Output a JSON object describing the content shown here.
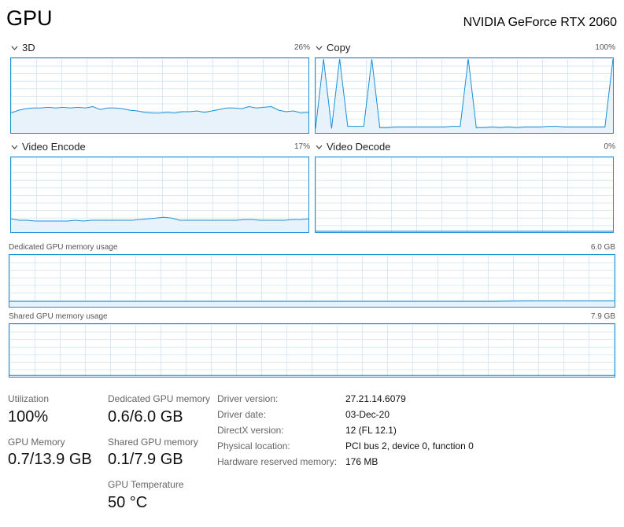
{
  "header": {
    "title": "GPU",
    "gpu_name": "NVIDIA GeForce RTX 2060"
  },
  "engines": [
    {
      "label": "3D",
      "percent": "26%"
    },
    {
      "label": "Copy",
      "percent": "100%"
    },
    {
      "label": "Video Encode",
      "percent": "17%"
    },
    {
      "label": "Video Decode",
      "percent": "0%"
    }
  ],
  "memory_graphs": {
    "dedicated": {
      "label": "Dedicated GPU memory usage",
      "max": "6.0 GB"
    },
    "shared": {
      "label": "Shared GPU memory usage",
      "max": "7.9 GB"
    }
  },
  "stats": {
    "utilization": {
      "label": "Utilization",
      "value": "100%"
    },
    "dedicated_memory": {
      "label": "Dedicated GPU memory",
      "value": "0.6/6.0 GB"
    },
    "gpu_memory": {
      "label": "GPU Memory",
      "value": "0.7/13.9 GB"
    },
    "shared_memory": {
      "label": "Shared GPU memory",
      "value": "0.1/7.9 GB"
    },
    "temperature": {
      "label": "GPU Temperature",
      "value": "50 °C"
    }
  },
  "details": [
    {
      "label": "Driver version:",
      "value": "27.21.14.6079"
    },
    {
      "label": "Driver date:",
      "value": "03-Dec-20"
    },
    {
      "label": "DirectX version:",
      "value": "12 (FL 12.1)"
    },
    {
      "label": "Physical location:",
      "value": "PCI bus 2, device 0, function 0"
    },
    {
      "label": "Hardware reserved memory:",
      "value": "176 MB"
    }
  ],
  "colors": {
    "graph_line": "#1a8fd6",
    "graph_fill": "#e8f2fa",
    "grid": "#d6e9f5"
  },
  "chart_data": [
    {
      "type": "area",
      "series": [
        {
          "name": "3D",
          "values": [
            26,
            30,
            32,
            33,
            33,
            34,
            33,
            34,
            33,
            34,
            33,
            35,
            31,
            33,
            33,
            32,
            30,
            29,
            27,
            26,
            26,
            27,
            26,
            28,
            28,
            29,
            27,
            29,
            31,
            33,
            33,
            32,
            35,
            33,
            34,
            35,
            30,
            28,
            29,
            26,
            27
          ]
        }
      ],
      "ylim": [
        0,
        100
      ]
    },
    {
      "type": "area",
      "series": [
        {
          "name": "Copy",
          "values": [
            5,
            100,
            5,
            100,
            8,
            8,
            8,
            100,
            6,
            6,
            7,
            7,
            7,
            7,
            7,
            7,
            7,
            8,
            8,
            100,
            6,
            6,
            7,
            6,
            7,
            6,
            7,
            7,
            7,
            8,
            8,
            7,
            7,
            7,
            7,
            7,
            7,
            100
          ]
        }
      ],
      "ylim": [
        0,
        100
      ]
    },
    {
      "type": "area",
      "series": [
        {
          "name": "Video Encode",
          "values": [
            17,
            15,
            15,
            14,
            14,
            14,
            14,
            14,
            15,
            14,
            15,
            15,
            15,
            15,
            15,
            15,
            16,
            17,
            18,
            19,
            18,
            15,
            15,
            15,
            15,
            15,
            15,
            15,
            15,
            16,
            16,
            15,
            15,
            15,
            15,
            16,
            16,
            17
          ]
        }
      ],
      "ylim": [
        0,
        100
      ]
    },
    {
      "type": "area",
      "series": [
        {
          "name": "Video Decode",
          "values": [
            0,
            0,
            0,
            0,
            0,
            0,
            0,
            0,
            0,
            0,
            0,
            0,
            0,
            0,
            0,
            0,
            0,
            0,
            0,
            0
          ]
        }
      ],
      "ylim": [
        0,
        100
      ]
    },
    {
      "type": "area",
      "series": [
        {
          "name": "Dedicated GPU memory usage",
          "values": [
            0.55,
            0.55,
            0.55,
            0.55,
            0.55,
            0.55,
            0.55,
            0.55,
            0.55,
            0.55,
            0.55,
            0.55,
            0.55,
            0.55,
            0.55,
            0.55,
            0.55,
            0.6,
            0.6,
            0.6,
            0.6
          ]
        }
      ],
      "ylim": [
        0,
        6.0
      ]
    },
    {
      "type": "area",
      "series": [
        {
          "name": "Shared GPU memory usage",
          "values": [
            0.1,
            0.1,
            0.1,
            0.1,
            0.1,
            0.1,
            0.1,
            0.1,
            0.1,
            0.1,
            0.1,
            0.1,
            0.1,
            0.1,
            0.1,
            0.1,
            0.1,
            0.1,
            0.1,
            0.1,
            0.1
          ]
        }
      ],
      "ylim": [
        0,
        7.9
      ]
    }
  ]
}
